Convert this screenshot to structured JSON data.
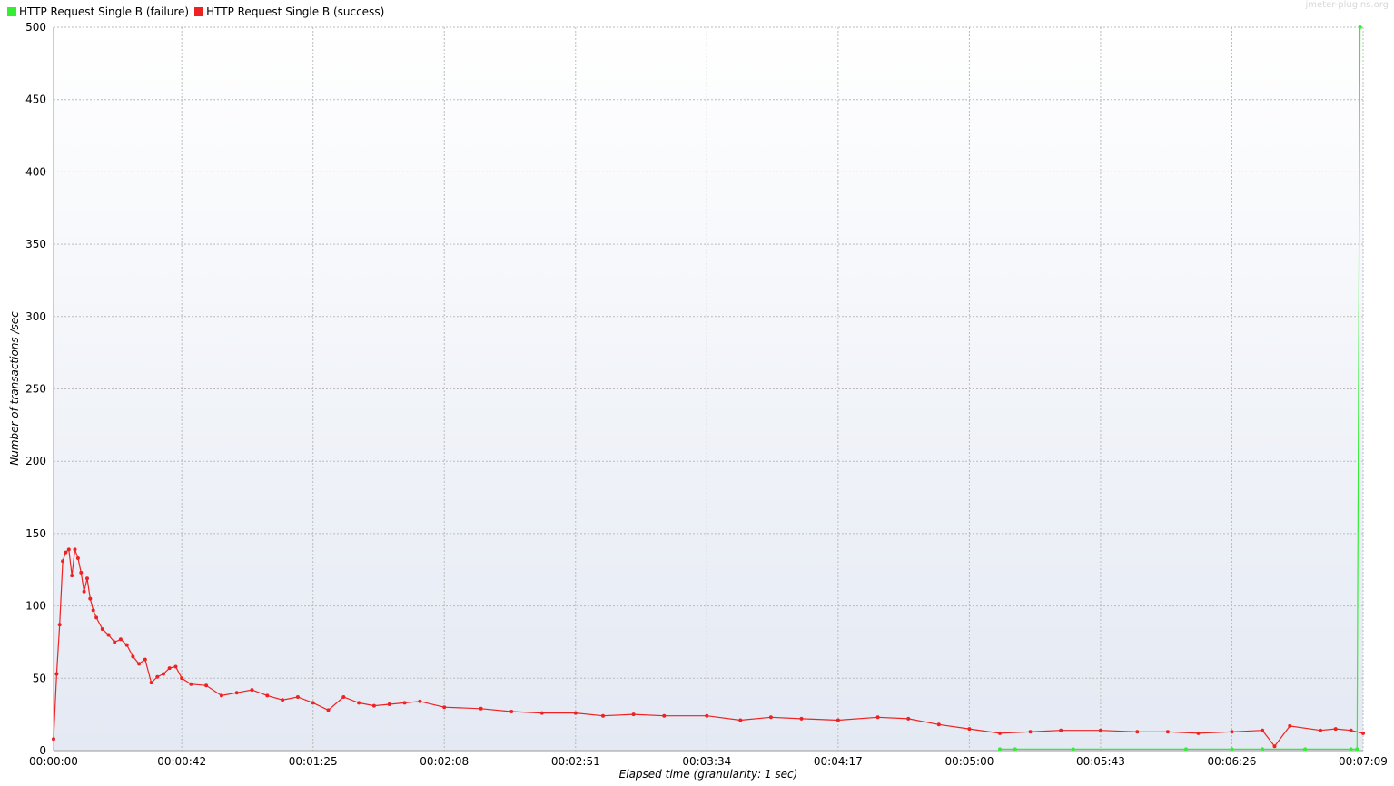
{
  "legend": {
    "failure_label": "HTTP Request Single B (failure)",
    "success_label": "HTTP Request Single B (success)"
  },
  "watermark": "jmeter-plugins.org",
  "chart_data": {
    "type": "line",
    "title": "",
    "xlabel": "Elapsed time (granularity: 1 sec)",
    "ylabel": "Number of transactions /sec",
    "xlim": [
      "00:00:00",
      "00:07:09"
    ],
    "ylim": [
      0,
      500
    ],
    "grid": true,
    "legend_position": "top-left",
    "x_ticks": [
      "00:00:00",
      "00:00:42",
      "00:01:25",
      "00:02:08",
      "00:02:51",
      "00:03:34",
      "00:04:17",
      "00:05:00",
      "00:05:43",
      "00:06:26",
      "00:07:09"
    ],
    "y_ticks": [
      0,
      50,
      100,
      150,
      200,
      250,
      300,
      350,
      400,
      450,
      500
    ],
    "series": [
      {
        "name": "HTTP Request Single B (failure)",
        "color": "#33ee33",
        "x": [
          "00:05:10",
          "00:05:15",
          "00:05:34",
          "00:06:11",
          "00:06:26",
          "00:06:36",
          "00:06:50",
          "00:07:05",
          "00:07:07",
          "00:07:08"
        ],
        "values": [
          1,
          1,
          1,
          1,
          1,
          1,
          1,
          1,
          1,
          500
        ]
      },
      {
        "name": "HTTP Request Single B (success)",
        "color": "#ee2222",
        "x": [
          "00:00:00",
          "00:00:01",
          "00:00:02",
          "00:00:03",
          "00:00:04",
          "00:00:05",
          "00:00:06",
          "00:00:07",
          "00:00:08",
          "00:00:09",
          "00:00:10",
          "00:00:11",
          "00:00:12",
          "00:00:13",
          "00:00:14",
          "00:00:16",
          "00:00:18",
          "00:00:20",
          "00:00:22",
          "00:00:24",
          "00:00:26",
          "00:00:28",
          "00:00:30",
          "00:00:32",
          "00:00:34",
          "00:00:36",
          "00:00:38",
          "00:00:40",
          "00:00:42",
          "00:00:45",
          "00:00:50",
          "00:00:55",
          "00:01:00",
          "00:01:05",
          "00:01:10",
          "00:01:15",
          "00:01:20",
          "00:01:25",
          "00:01:30",
          "00:01:35",
          "00:01:40",
          "00:01:45",
          "00:01:50",
          "00:01:55",
          "00:02:00",
          "00:02:08",
          "00:02:20",
          "00:02:30",
          "00:02:40",
          "00:02:51",
          "00:03:00",
          "00:03:10",
          "00:03:20",
          "00:03:34",
          "00:03:45",
          "00:03:55",
          "00:04:05",
          "00:04:17",
          "00:04:30",
          "00:04:40",
          "00:04:50",
          "00:05:00",
          "00:05:10",
          "00:05:20",
          "00:05:30",
          "00:05:43",
          "00:05:55",
          "00:06:05",
          "00:06:15",
          "00:06:26",
          "00:06:36",
          "00:06:40",
          "00:06:45",
          "00:06:55",
          "00:07:00",
          "00:07:05",
          "00:07:09"
        ],
        "values": [
          8,
          53,
          87,
          131,
          137,
          139,
          121,
          139,
          133,
          123,
          110,
          119,
          105,
          97,
          92,
          84,
          80,
          75,
          77,
          73,
          65,
          60,
          63,
          47,
          51,
          53,
          57,
          58,
          50,
          46,
          45,
          38,
          40,
          42,
          38,
          35,
          37,
          33,
          28,
          37,
          33,
          31,
          32,
          33,
          34,
          30,
          29,
          27,
          26,
          26,
          24,
          25,
          24,
          24,
          21,
          23,
          22,
          21,
          23,
          22,
          18,
          15,
          12,
          13,
          14,
          14,
          13,
          13,
          12,
          13,
          14,
          3,
          17,
          14,
          15,
          14,
          12
        ]
      }
    ]
  }
}
